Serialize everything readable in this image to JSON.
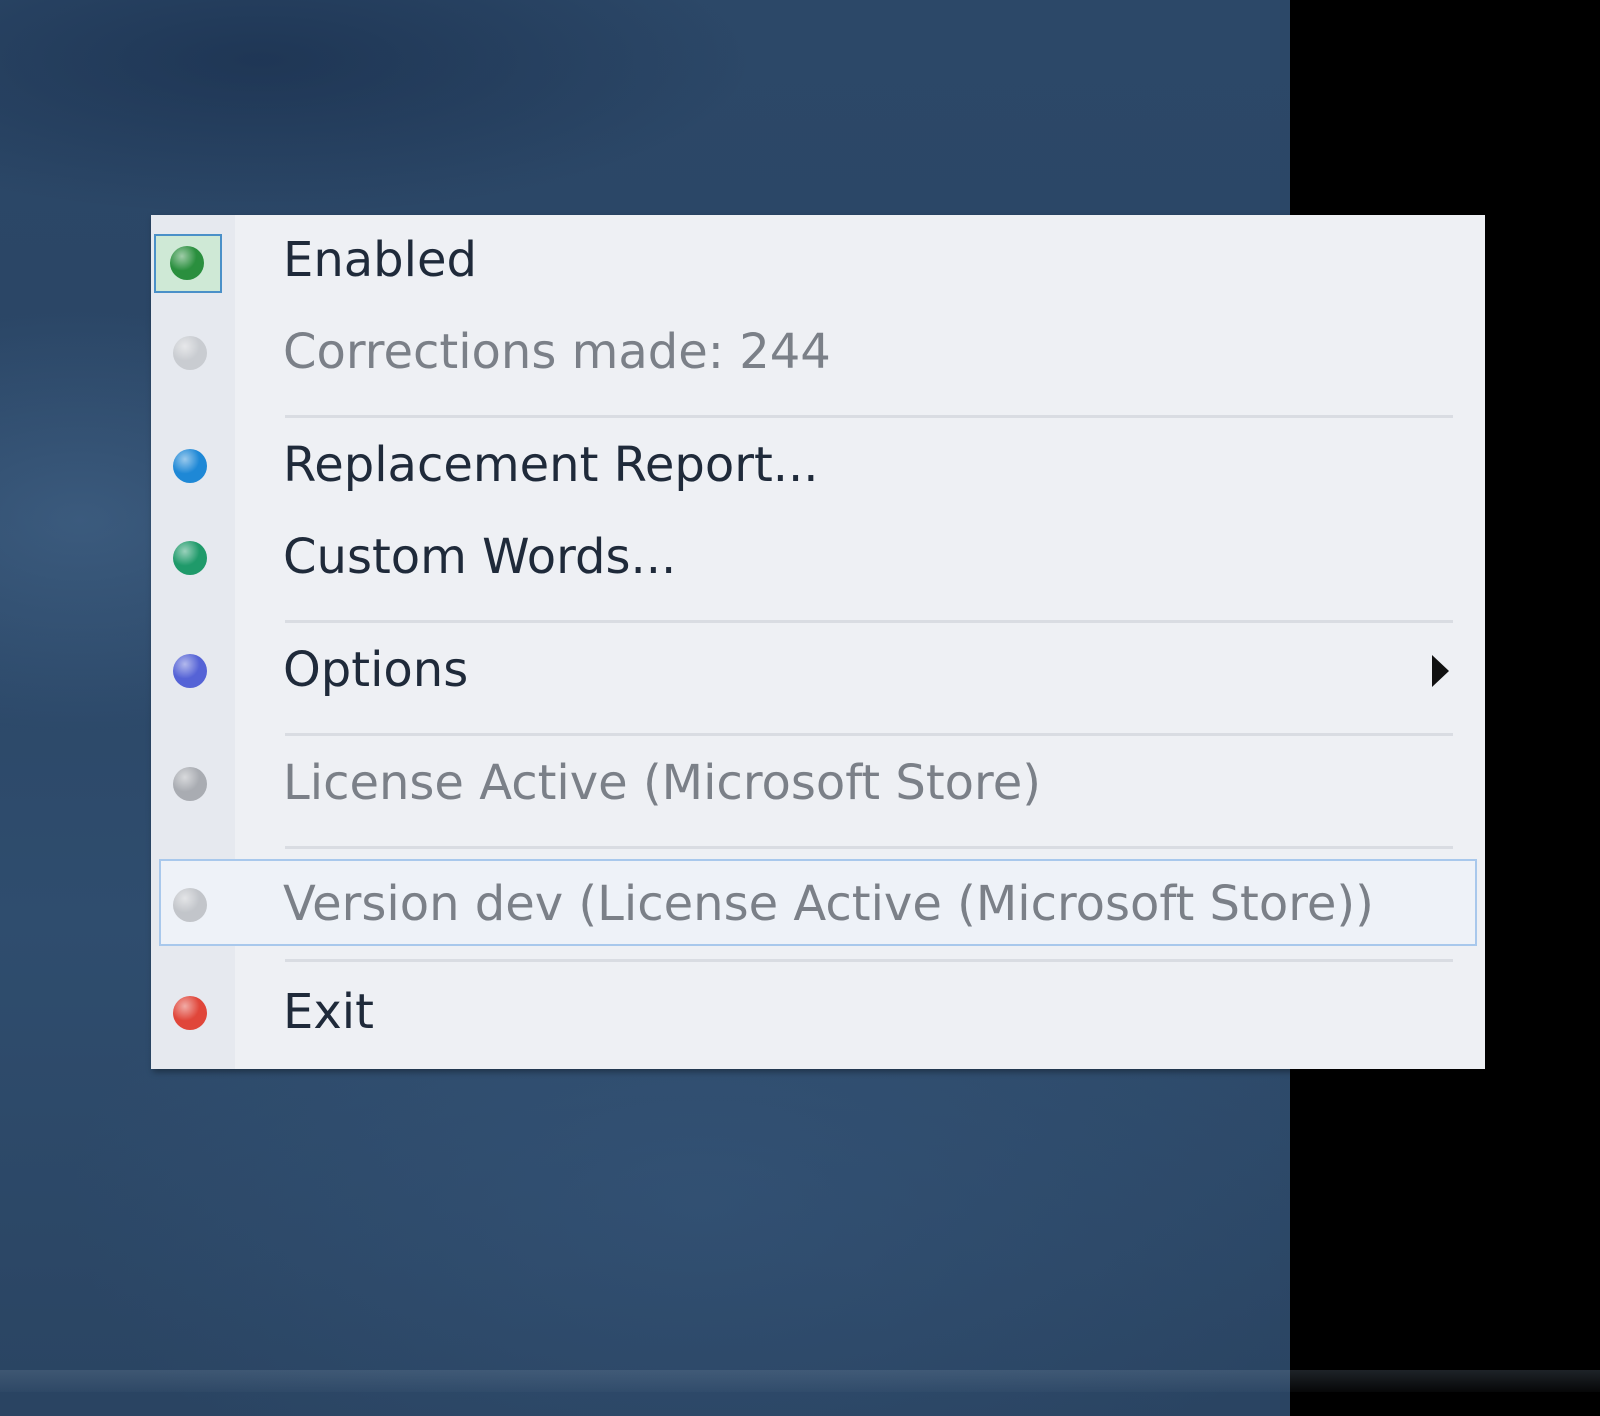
{
  "menu": {
    "items": [
      {
        "label": "Enabled",
        "dot_color": "#2a8f3e",
        "checked": true,
        "enabled": true
      },
      {
        "label": "Corrections made: 244",
        "dot_color": "#c9ccd1",
        "enabled": false
      },
      {
        "label": "Replacement Report...",
        "dot_color": "#1e88d6",
        "enabled": true
      },
      {
        "label": "Custom Words...",
        "dot_color": "#1f9a6a",
        "enabled": true
      },
      {
        "label": "Options",
        "dot_color": "#5563d6",
        "enabled": true,
        "has_submenu": true
      },
      {
        "label": "License Active (Microsoft Store)",
        "dot_color": "#a9acb2",
        "enabled": false
      },
      {
        "label": "Version dev (License Active (Microsoft Store))",
        "dot_color": "#c2c5ca",
        "enabled": false,
        "highlighted": true
      },
      {
        "label": "Exit",
        "dot_color": "#e0463a",
        "enabled": true
      }
    ]
  }
}
